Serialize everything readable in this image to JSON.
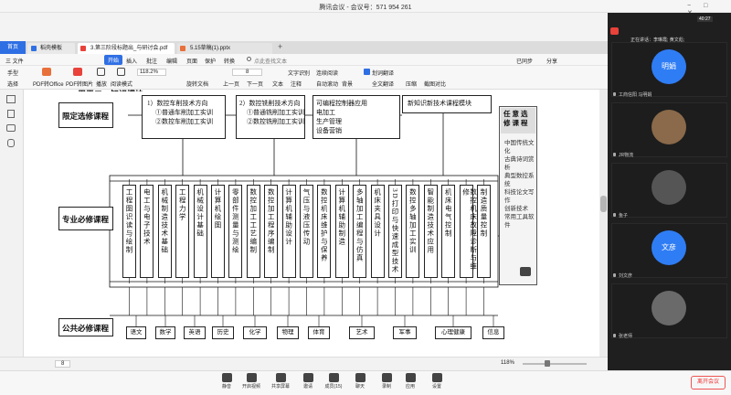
{
  "meeting": {
    "title": "腾讯会议 - 会议号：571 954 261",
    "time": "40:27",
    "leave": "离开会议"
  },
  "wps": {
    "home": "首页",
    "tabs": [
      "稻壳模板",
      "3.第三阶段标题出_与研讨会.pdf",
      "5.15草稿(1).pptx"
    ],
    "menu": [
      "三 文件",
      "开始",
      "插入",
      "批注",
      "编辑",
      "页面",
      "保护",
      "转换",
      "点此查找文本"
    ],
    "menu_right": [
      "已同步",
      "分享"
    ],
    "toolbar": [
      "手型",
      "选择",
      "PDF转Office",
      "PDF转图片",
      "播放",
      "阅读模式",
      "旋转文档",
      "上一页",
      "下一页",
      "文本",
      "注释",
      "文字识别",
      "连续阅读",
      "自动滚动",
      "背景",
      "划词翻译",
      "全文翻译",
      "压缩",
      "截图对比"
    ],
    "zoom": "118.2%",
    "page": "8",
    "status_page": "8",
    "status_zoom": "118%"
  },
  "doc": {
    "partial_top": "用于二、知识模块",
    "left_labels": [
      "限定选修课程",
      "专业必修课程",
      "公共必修课程"
    ],
    "elective_boxes": [
      {
        "title": "1）数控车削技术方向",
        "items": [
          "①普通车削加工实训",
          "②数控车削加工实训"
        ]
      },
      {
        "title": "2）数控铣削技术方向",
        "items": [
          "①普通铣削加工实训",
          "②数控铣削加工实训"
        ]
      },
      {
        "title": "",
        "items": [
          "可编程控制器应用",
          "电加工",
          "生产管理",
          "设备营销"
        ]
      },
      {
        "title": "新知识新技术课程模块",
        "items": []
      }
    ],
    "any_elective": {
      "title": "任意选修课程",
      "items": [
        "中国传统文化",
        "古典诗词赏析",
        "典型数控系统",
        "科技论文写作",
        "创新技术",
        "常用工具软件"
      ]
    },
    "core_courses": [
      "工程图识读与绘制",
      "电工与电子技术",
      "机械制造技术基础",
      "工程力学",
      "机械设计基础",
      "计算机绘图",
      "零部件测量与测绘",
      "数控加工工艺编制",
      "数控加工程序编制",
      "计算机辅助设计",
      "气压与液压传动",
      "数控机床维护与保养",
      "计算机辅助制造",
      "多轴加工编程与仿真",
      "机床夹具设计",
      "3D打印与快速成型技术",
      "数控多轴加工实训",
      "智能制造技术应用",
      "机床电气控制",
      "数控机床故障诊断与维修",
      "制造质量控制"
    ],
    "public_courses": [
      "语文",
      "数学",
      "英语",
      "历史",
      "化学",
      "物理",
      "体育",
      "艺术",
      "军事",
      "心理健康",
      "信息"
    ]
  },
  "participants": {
    "status": "正在讲话：李琳霞; 黄文彪;",
    "list": [
      {
        "avatar": "明娟",
        "name": "工商信阳 马明娟"
      },
      {
        "avatar": "",
        "name": "JR物流"
      },
      {
        "avatar": "",
        "name": "鱼子"
      },
      {
        "avatar": "文彦",
        "name": "刘文彦"
      },
      {
        "avatar": "",
        "name": "张老师"
      }
    ]
  },
  "controls": [
    "静音",
    "开启视频",
    "共享屏幕",
    "邀请",
    "成员(15)",
    "聊天",
    "录制",
    "应用",
    "设置"
  ]
}
